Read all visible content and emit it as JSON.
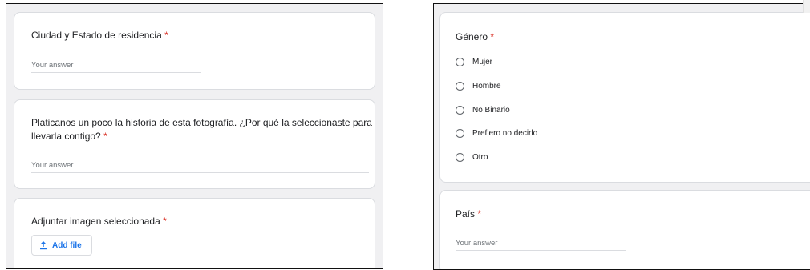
{
  "left_form": {
    "city_question": {
      "title": "Ciudad y Estado de residencia",
      "required_mark": "*",
      "placeholder": "Your answer"
    },
    "story_question": {
      "title_line1": "Platicanos un poco la historia de esta fotografía. ¿Por qué la seleccionaste para",
      "title_line2": "llevarla contigo?",
      "required_mark": "*",
      "placeholder": "Your answer"
    },
    "image_question": {
      "title": "Adjuntar imagen seleccionada",
      "required_mark": "*",
      "button_label": "Add file",
      "button_icon": "upload-icon"
    }
  },
  "right_form": {
    "gender_question": {
      "title": "Género",
      "required_mark": "*",
      "options": [
        "Mujer",
        "Hombre",
        "No Binario",
        "Prefiero no decirlo",
        "Otro"
      ]
    },
    "country_question": {
      "title": "País",
      "required_mark": "*",
      "placeholder": "Your answer"
    }
  },
  "colors": {
    "accent": "#1a73e8",
    "required": "#d93025",
    "panel_background": "#f0f0f2"
  }
}
